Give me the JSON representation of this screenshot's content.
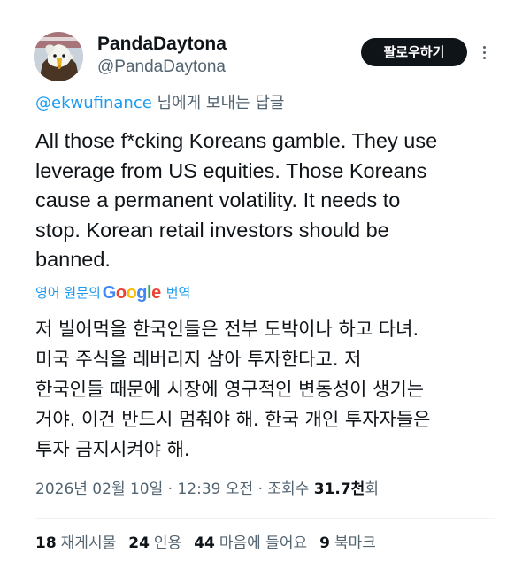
{
  "author": {
    "display_name": "PandaDaytona",
    "handle": "@PandaDaytona",
    "avatar_icon": "bald-eagle-avatar"
  },
  "header": {
    "follow_label": "팔로우하기",
    "more_icon": "vertical-ellipsis-icon"
  },
  "reply": {
    "mention": "@ekwufinance",
    "suffix": " 님에게 보내는 답글"
  },
  "tweet": {
    "lines": [
      "All those f*cking Koreans gamble. They use",
      "leverage from US equities. Those Koreans",
      "cause a permanent volatility. It needs to",
      "stop. Korean retail investors should be",
      "banned."
    ]
  },
  "translation": {
    "prefix": "영어 원문의",
    "provider": "Google",
    "suffix": "번역",
    "lines": [
      "저 빌어먹을 한국인들은 전부 도박이나 하고 다녀.",
      "미국 주식을 레버리지 삼아 투자한다고. 저",
      "한국인들 때문에 시장에 영구적인 변동성이 생기는",
      "거야. 이건 반드시 멈춰야 해. 한국 개인 투자자들은",
      "투자 금지시켜야 해."
    ]
  },
  "meta": {
    "date": "2026년 02월 10일",
    "time": "12:39 오전",
    "views_label": "조회수",
    "views_count": "31.7천",
    "views_suffix": "회"
  },
  "stats": [
    {
      "count": "18",
      "label": "재게시물"
    },
    {
      "count": "24",
      "label": "인용"
    },
    {
      "count": "44",
      "label": "마음에 들어요"
    },
    {
      "count": "9",
      "label": "북마크"
    }
  ],
  "colors": {
    "link": "#1d9bf0",
    "secondary_text": "#536471",
    "primary_text": "#0f1419",
    "button_bg": "#0f1419"
  }
}
